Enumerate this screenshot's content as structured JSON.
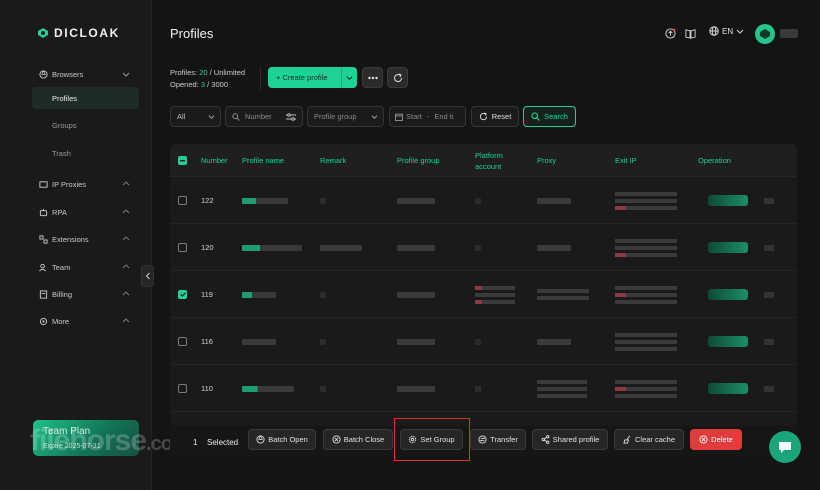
{
  "brand": {
    "logo_text": "DICLOAK"
  },
  "sidebar": {
    "browsers": {
      "label": "Browsers",
      "sub": [
        "Profiles",
        "Groups",
        "Trash"
      ]
    },
    "items": [
      {
        "label": "IP Proxies"
      },
      {
        "label": "RPA"
      },
      {
        "label": "Extensions"
      },
      {
        "label": "Team"
      },
      {
        "label": "Billing"
      },
      {
        "label": "More"
      }
    ],
    "team_card": {
      "title": "Team Plan",
      "expire": "Expire 2025-07-31"
    }
  },
  "watermark": {
    "main": "filehorse",
    "suffix": ".com"
  },
  "header": {
    "title": "Profiles",
    "lang": "EN"
  },
  "stats": {
    "profiles_label": "Profiles:",
    "profiles_value": "20",
    "profiles_limit": "/ Unlimited",
    "opened_label": "Opened:",
    "opened_value": "3",
    "opened_limit": "/ 3000"
  },
  "toolbar": {
    "create_label": "+ Create profile"
  },
  "filters": {
    "all": "All",
    "number_placeholder": "Number",
    "group_placeholder": "Profile group",
    "start": "Start",
    "dash": "-",
    "end": "End ti",
    "reset": "Reset",
    "search": "Search"
  },
  "table": {
    "headers": {
      "number": "Number",
      "name": "Profile name",
      "remark": "Remark",
      "group": "Profile group",
      "platform_1": "Platform",
      "platform_2": "account",
      "proxy": "Proxy",
      "exit_ip": "Exit IP",
      "operation": "Operation"
    },
    "rows": [
      {
        "number": "122",
        "checked": false
      },
      {
        "number": "120",
        "checked": false
      },
      {
        "number": "119",
        "checked": true
      },
      {
        "number": "116",
        "checked": false
      },
      {
        "number": "110",
        "checked": false
      }
    ]
  },
  "bottom_bar": {
    "selected_count": "1",
    "selected_label": "Selected",
    "actions": {
      "batch_open": "Batch Open",
      "batch_close": "Batch Close",
      "set_group": "Set Group",
      "transfer": "Transfer",
      "shared_profile": "Shared profile",
      "clear_cache": "Clear cache",
      "delete": "Delete"
    }
  },
  "colors": {
    "accent": "#1fd193",
    "danger": "#e03c3c",
    "highlight": "#e0312c",
    "background": "#141414"
  }
}
